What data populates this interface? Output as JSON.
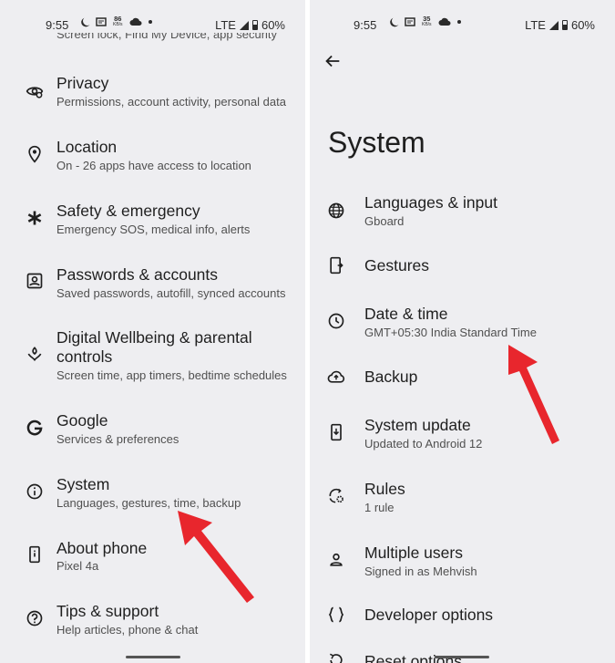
{
  "left": {
    "status": {
      "time": "9:55",
      "speed_value": "86",
      "speed_unit": "KB/s",
      "network": "LTE",
      "battery": "60%"
    },
    "cut_off_text": "Screen lock, Find My Device, app security",
    "items": [
      {
        "title": "Privacy",
        "subtitle": "Permissions, account activity, personal data",
        "icon": "privacy-eye-icon"
      },
      {
        "title": "Location",
        "subtitle": "On - 26 apps have access to location",
        "icon": "location-pin-icon"
      },
      {
        "title": "Safety & emergency",
        "subtitle": "Emergency SOS, medical info, alerts",
        "icon": "asterisk-icon"
      },
      {
        "title": "Passwords & accounts",
        "subtitle": "Saved passwords, autofill, synced accounts",
        "icon": "account-box-icon"
      },
      {
        "title": "Digital Wellbeing & parental",
        "title2": "controls",
        "subtitle": "Screen time, app timers, bedtime schedules",
        "icon": "wellbeing-icon"
      },
      {
        "title": "Google",
        "subtitle": "Services & preferences",
        "icon": "google-g-icon"
      },
      {
        "title": "System",
        "subtitle": "Languages, gestures, time, backup",
        "icon": "info-circle-icon"
      },
      {
        "title": "About phone",
        "subtitle": "Pixel 4a",
        "icon": "phone-icon"
      },
      {
        "title": "Tips & support",
        "subtitle": "Help articles, phone & chat",
        "icon": "help-circle-icon"
      }
    ]
  },
  "right": {
    "status": {
      "time": "9:55",
      "speed_value": "35",
      "speed_unit": "KB/s",
      "network": "LTE",
      "battery": "60%"
    },
    "page_title": "System",
    "items": [
      {
        "title": "Languages & input",
        "subtitle": "Gboard",
        "icon": "globe-icon"
      },
      {
        "title": "Gestures",
        "subtitle": "",
        "icon": "gestures-phone-icon"
      },
      {
        "title": "Date & time",
        "subtitle": "GMT+05:30 India Standard Time",
        "icon": "clock-icon"
      },
      {
        "title": "Backup",
        "subtitle": "",
        "icon": "cloud-upload-icon"
      },
      {
        "title": "System update",
        "subtitle": "Updated to Android 12",
        "icon": "system-update-icon"
      },
      {
        "title": "Rules",
        "subtitle": "1 rule",
        "icon": "rules-icon"
      },
      {
        "title": "Multiple users",
        "subtitle": "Signed in as Mehvish",
        "icon": "person-icon"
      },
      {
        "title": "Developer options",
        "subtitle": "",
        "icon": "braces-icon"
      },
      {
        "title": "Reset options",
        "subtitle": "",
        "icon": "reset-icon"
      }
    ]
  },
  "colors": {
    "background": "#eeeef1",
    "arrow": "#e8262d",
    "text": "#1f1f1f",
    "subtext": "#505050"
  }
}
